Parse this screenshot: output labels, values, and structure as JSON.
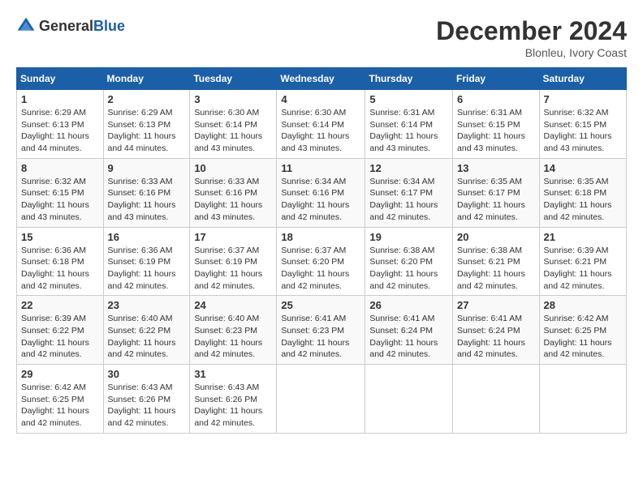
{
  "header": {
    "logo_general": "General",
    "logo_blue": "Blue",
    "month_title": "December 2024",
    "location": "Blonleu, Ivory Coast"
  },
  "weekdays": [
    "Sunday",
    "Monday",
    "Tuesday",
    "Wednesday",
    "Thursday",
    "Friday",
    "Saturday"
  ],
  "weeks": [
    [
      {
        "day": "1",
        "sunrise": "6:29 AM",
        "sunset": "6:13 PM",
        "daylight": "11 hours and 44 minutes."
      },
      {
        "day": "2",
        "sunrise": "6:29 AM",
        "sunset": "6:13 PM",
        "daylight": "11 hours and 44 minutes."
      },
      {
        "day": "3",
        "sunrise": "6:30 AM",
        "sunset": "6:14 PM",
        "daylight": "11 hours and 43 minutes."
      },
      {
        "day": "4",
        "sunrise": "6:30 AM",
        "sunset": "6:14 PM",
        "daylight": "11 hours and 43 minutes."
      },
      {
        "day": "5",
        "sunrise": "6:31 AM",
        "sunset": "6:14 PM",
        "daylight": "11 hours and 43 minutes."
      },
      {
        "day": "6",
        "sunrise": "6:31 AM",
        "sunset": "6:15 PM",
        "daylight": "11 hours and 43 minutes."
      },
      {
        "day": "7",
        "sunrise": "6:32 AM",
        "sunset": "6:15 PM",
        "daylight": "11 hours and 43 minutes."
      }
    ],
    [
      {
        "day": "8",
        "sunrise": "6:32 AM",
        "sunset": "6:15 PM",
        "daylight": "11 hours and 43 minutes."
      },
      {
        "day": "9",
        "sunrise": "6:33 AM",
        "sunset": "6:16 PM",
        "daylight": "11 hours and 43 minutes."
      },
      {
        "day": "10",
        "sunrise": "6:33 AM",
        "sunset": "6:16 PM",
        "daylight": "11 hours and 43 minutes."
      },
      {
        "day": "11",
        "sunrise": "6:34 AM",
        "sunset": "6:16 PM",
        "daylight": "11 hours and 42 minutes."
      },
      {
        "day": "12",
        "sunrise": "6:34 AM",
        "sunset": "6:17 PM",
        "daylight": "11 hours and 42 minutes."
      },
      {
        "day": "13",
        "sunrise": "6:35 AM",
        "sunset": "6:17 PM",
        "daylight": "11 hours and 42 minutes."
      },
      {
        "day": "14",
        "sunrise": "6:35 AM",
        "sunset": "6:18 PM",
        "daylight": "11 hours and 42 minutes."
      }
    ],
    [
      {
        "day": "15",
        "sunrise": "6:36 AM",
        "sunset": "6:18 PM",
        "daylight": "11 hours and 42 minutes."
      },
      {
        "day": "16",
        "sunrise": "6:36 AM",
        "sunset": "6:19 PM",
        "daylight": "11 hours and 42 minutes."
      },
      {
        "day": "17",
        "sunrise": "6:37 AM",
        "sunset": "6:19 PM",
        "daylight": "11 hours and 42 minutes."
      },
      {
        "day": "18",
        "sunrise": "6:37 AM",
        "sunset": "6:20 PM",
        "daylight": "11 hours and 42 minutes."
      },
      {
        "day": "19",
        "sunrise": "6:38 AM",
        "sunset": "6:20 PM",
        "daylight": "11 hours and 42 minutes."
      },
      {
        "day": "20",
        "sunrise": "6:38 AM",
        "sunset": "6:21 PM",
        "daylight": "11 hours and 42 minutes."
      },
      {
        "day": "21",
        "sunrise": "6:39 AM",
        "sunset": "6:21 PM",
        "daylight": "11 hours and 42 minutes."
      }
    ],
    [
      {
        "day": "22",
        "sunrise": "6:39 AM",
        "sunset": "6:22 PM",
        "daylight": "11 hours and 42 minutes."
      },
      {
        "day": "23",
        "sunrise": "6:40 AM",
        "sunset": "6:22 PM",
        "daylight": "11 hours and 42 minutes."
      },
      {
        "day": "24",
        "sunrise": "6:40 AM",
        "sunset": "6:23 PM",
        "daylight": "11 hours and 42 minutes."
      },
      {
        "day": "25",
        "sunrise": "6:41 AM",
        "sunset": "6:23 PM",
        "daylight": "11 hours and 42 minutes."
      },
      {
        "day": "26",
        "sunrise": "6:41 AM",
        "sunset": "6:24 PM",
        "daylight": "11 hours and 42 minutes."
      },
      {
        "day": "27",
        "sunrise": "6:41 AM",
        "sunset": "6:24 PM",
        "daylight": "11 hours and 42 minutes."
      },
      {
        "day": "28",
        "sunrise": "6:42 AM",
        "sunset": "6:25 PM",
        "daylight": "11 hours and 42 minutes."
      }
    ],
    [
      {
        "day": "29",
        "sunrise": "6:42 AM",
        "sunset": "6:25 PM",
        "daylight": "11 hours and 42 minutes."
      },
      {
        "day": "30",
        "sunrise": "6:43 AM",
        "sunset": "6:26 PM",
        "daylight": "11 hours and 42 minutes."
      },
      {
        "day": "31",
        "sunrise": "6:43 AM",
        "sunset": "6:26 PM",
        "daylight": "11 hours and 42 minutes."
      },
      null,
      null,
      null,
      null
    ]
  ]
}
